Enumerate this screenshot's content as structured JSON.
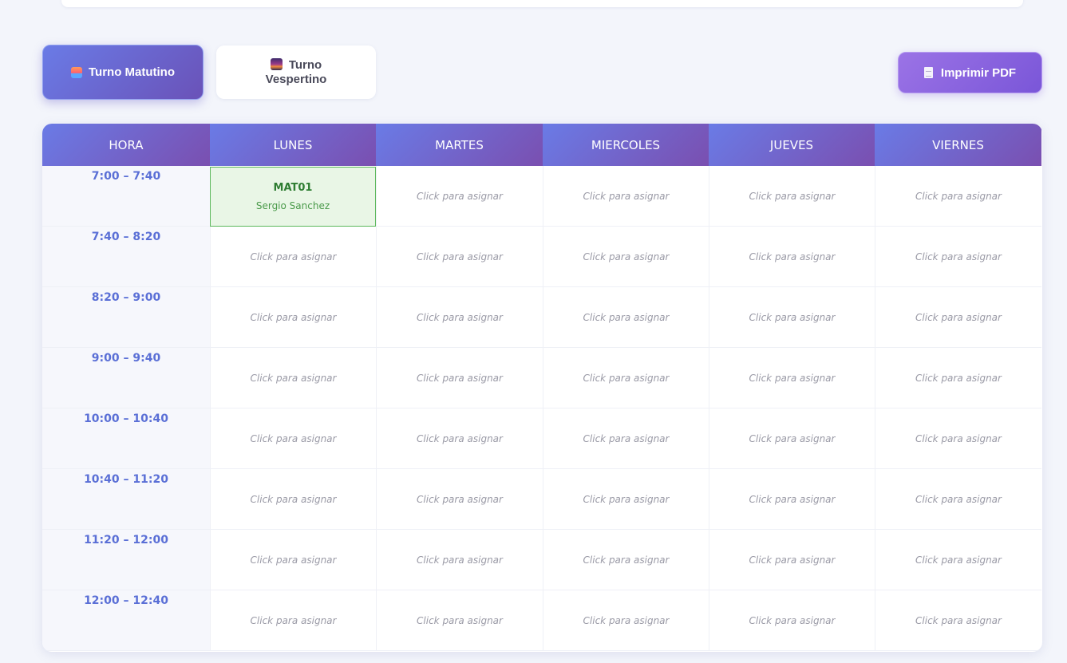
{
  "shifts": {
    "morning_label": "Turno Matutino",
    "afternoon_label": "Turno Vespertino",
    "active": "Turno Matutino"
  },
  "actions": {
    "print_label": "Imprimir PDF"
  },
  "table": {
    "headers": [
      "HORA",
      "LUNES",
      "MARTES",
      "MIERCOLES",
      "JUEVES",
      "VIERNES"
    ],
    "empty_label": "Click para asignar",
    "rows": [
      {
        "time": "7:00 – 7:40"
      },
      {
        "time": "7:40 – 8:20"
      },
      {
        "time": "8:20 – 9:00"
      },
      {
        "time": "9:00 – 9:40"
      },
      {
        "time": "10:00 – 10:40"
      },
      {
        "time": "10:40 – 11:20"
      },
      {
        "time": "11:20 – 12:00"
      },
      {
        "time": "12:00 – 12:40"
      }
    ],
    "assignments": [
      {
        "row": 0,
        "day": "LUNES",
        "code": "MAT01",
        "teacher": "Sergio Sanchez"
      }
    ]
  },
  "colors": {
    "primary": "#667eea",
    "secondary": "#764ba2",
    "assigned_bg": "#e9f6e6",
    "assigned_border": "#5cb85c"
  }
}
